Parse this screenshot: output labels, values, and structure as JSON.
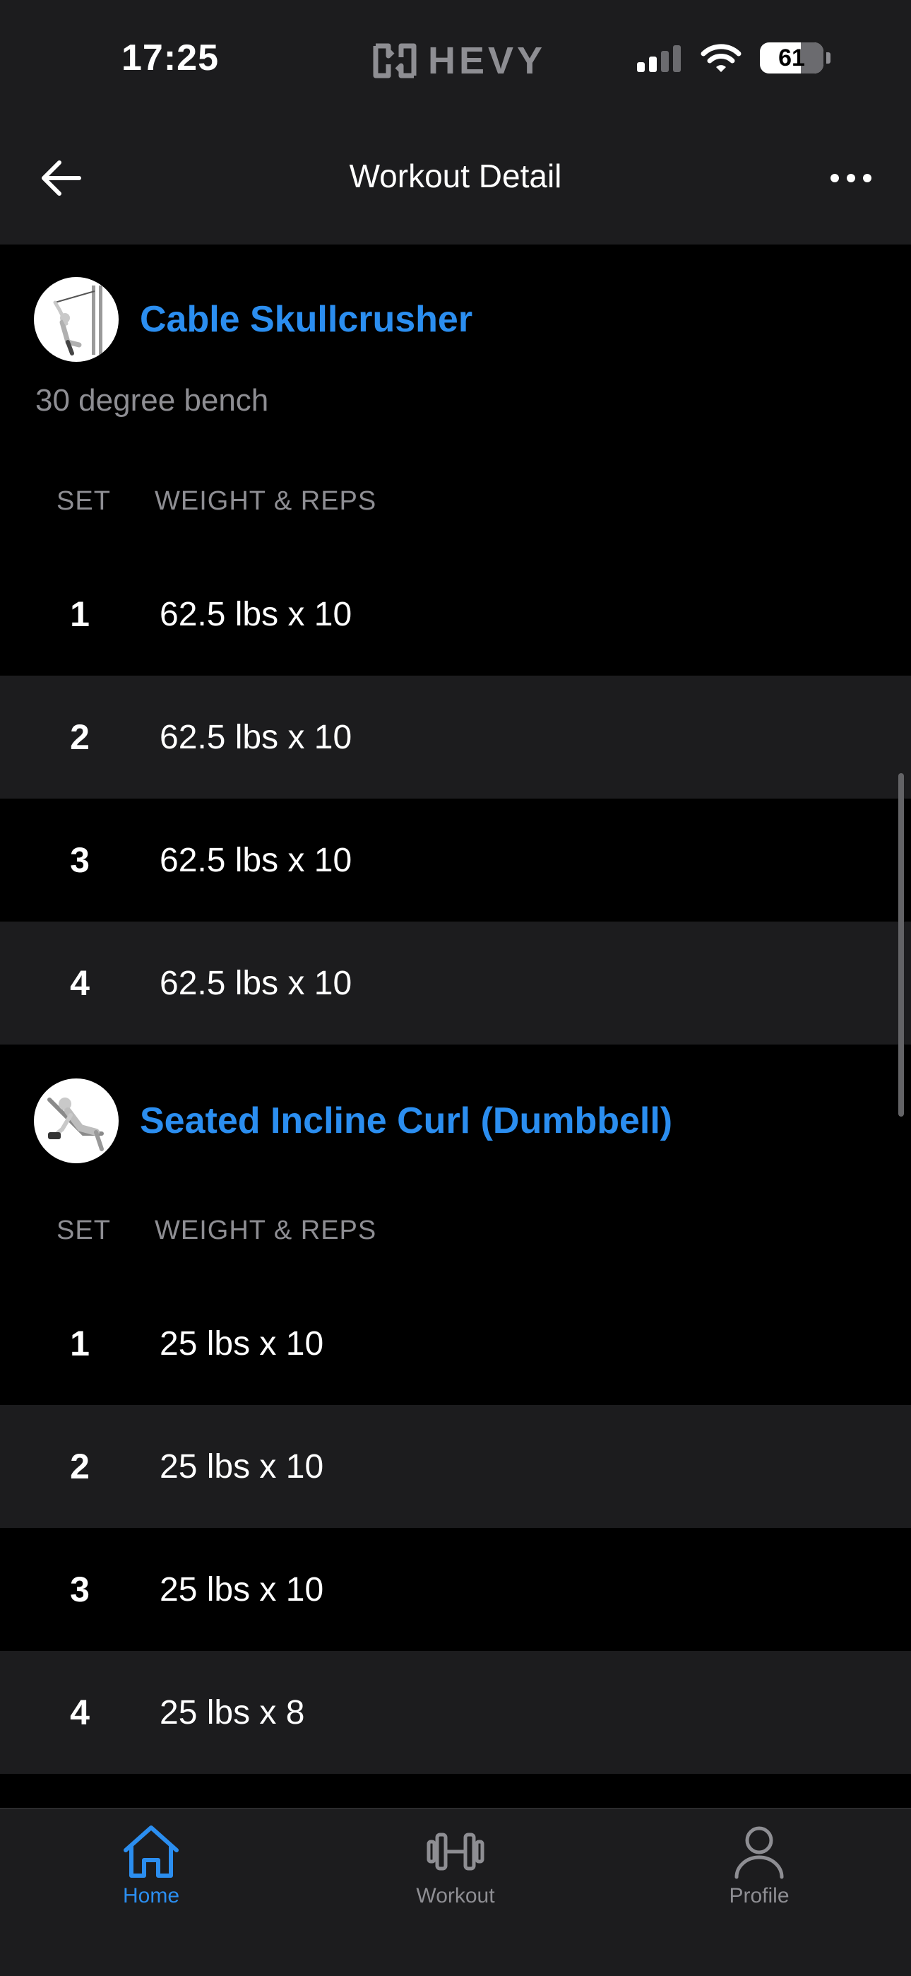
{
  "status_bar": {
    "time": "17:25",
    "brand": "HEVY",
    "battery": "61"
  },
  "header": {
    "title": "Workout Detail"
  },
  "exercises": [
    {
      "name": "Cable Skullcrusher",
      "note": "30 degree bench",
      "columns": {
        "set": "SET",
        "weight_reps": "WEIGHT & REPS"
      },
      "sets": [
        {
          "num": "1",
          "value": "62.5 lbs x 10"
        },
        {
          "num": "2",
          "value": "62.5 lbs x 10"
        },
        {
          "num": "3",
          "value": "62.5 lbs x 10"
        },
        {
          "num": "4",
          "value": "62.5 lbs x 10"
        }
      ]
    },
    {
      "name": "Seated Incline Curl (Dumbbell)",
      "columns": {
        "set": "SET",
        "weight_reps": "WEIGHT & REPS"
      },
      "sets": [
        {
          "num": "1",
          "value": "25 lbs x 10"
        },
        {
          "num": "2",
          "value": "25 lbs x 10"
        },
        {
          "num": "3",
          "value": "25 lbs x 10"
        },
        {
          "num": "4",
          "value": "25 lbs x 8"
        }
      ]
    }
  ],
  "tab_bar": {
    "tabs": [
      {
        "label": "Home",
        "icon": "home-icon",
        "active": true
      },
      {
        "label": "Workout",
        "icon": "dumbbell-icon",
        "active": false
      },
      {
        "label": "Profile",
        "icon": "profile-icon",
        "active": false
      }
    ]
  },
  "colors": {
    "accent": "#2b8ef0",
    "background": "#000000",
    "surface": "#1c1c1e",
    "muted_text": "#8e8e93"
  }
}
